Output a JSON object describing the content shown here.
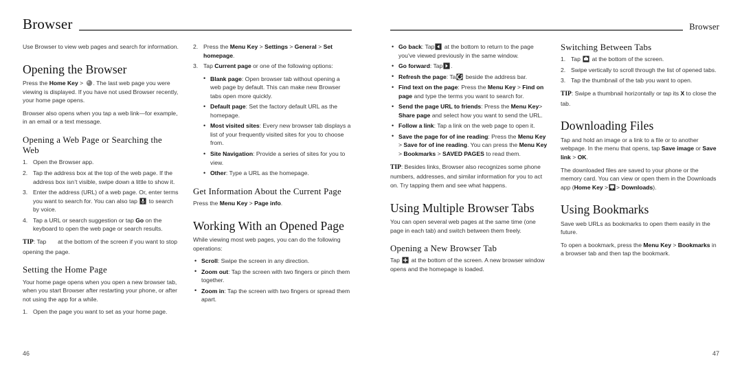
{
  "document": {
    "running_head_left": "Browser",
    "running_head_right": "Browser"
  },
  "left_page": {
    "page_number": "46",
    "col1": {
      "intro": "Use Browser to view web pages and search for information.",
      "h_opening_browser": "Opening the Browser",
      "opening_p1_a": "Press the ",
      "opening_p1_home_key": "Home Key",
      "opening_p1_b": " > ",
      "opening_p1_c": ". The last web page you were viewing is displayed. If you have not used Browser recently, your home page opens.",
      "opening_p2": "Browser also opens when you tap a web link—for example, in an email or a text message.",
      "h_opening_webpage": "Opening a Web Page or Searching the Web",
      "steps": [
        {
          "marker": "1.",
          "text": "Open the Browser app."
        },
        {
          "marker": "2.",
          "text": "Tap the address box at the top of the web page. If the address box isn’t visible, swipe down a little to show it."
        },
        {
          "marker": "3.",
          "text_a": "Enter the address (URL) of a web page. Or, enter terms you want to search for. You can also tap ",
          "icon": "microphone-icon",
          "text_b": " to search by voice."
        },
        {
          "marker": "4.",
          "text_a": "Tap a URL or search suggestion or tap ",
          "bold": "Go",
          "text_b": " on the keyboard to open the web page or search results."
        }
      ],
      "tip_label": "TIP",
      "tip_text_a": ": Tap ",
      "tip_text_b": "      at the bottom of the screen if you want to stop opening the page.",
      "h_setting_home": "Setting the Home Page",
      "setting_p1": "Your home page opens when you open a new browser tab, when you start Browser after restarting your phone, or after not using the app for a while.",
      "setting_step1_marker": "1.",
      "setting_step1": "Open the page you want to set as your home page."
    },
    "col2": {
      "step2_marker": "2.",
      "step2_a": "Press the ",
      "step2_menu_key": "Menu Key",
      "step2_b": " > ",
      "step2_settings": "Settings",
      "step2_c": " > ",
      "step2_general": "General",
      "step2_d": " > ",
      "step2_set_homepage": "Set homepage",
      "step2_e": ".",
      "step3_marker": "3.",
      "step3_a": "Tap ",
      "step3_current_page": "Current page",
      "step3_b": " or one of the following options:",
      "options": [
        {
          "label": "Blank page",
          "text": ": Open browser tab without opening a web page by default. This can make new Browser tabs open more quickly."
        },
        {
          "label": "Default page",
          "text": ": Set the factory default URL as the homepage."
        },
        {
          "label": "Most visited sites",
          "text": ": Every new browser tab displays a list of your frequently visited sites for you to choose from."
        },
        {
          "label": "Site Navigation",
          "text": ": Provide a series of sites for you to view."
        },
        {
          "label": "Other",
          "text": ": Type a URL as the homepage."
        }
      ],
      "h_get_info": "Get Information About the Current Page",
      "get_info_a": "Press the ",
      "get_info_menu_key": "Menu Key",
      "get_info_b": " > ",
      "get_info_page_info": "Page info",
      "get_info_c": ".",
      "h_working_with": "Working With an Opened Page",
      "working_p1": "While viewing most web pages, you can do the following operations:",
      "operations": [
        {
          "label": "Scroll",
          "text": ": Swipe the screen in any direction."
        },
        {
          "label": "Zoom out",
          "text": ": Tap the screen with two fingers or pinch them together."
        },
        {
          "label": "Zoom in",
          "text": ": Tap the screen with two fingers or spread them apart."
        }
      ]
    }
  },
  "right_page": {
    "page_number": "47",
    "col1": {
      "bullets": [
        {
          "label": "Go back",
          "text_a": ": Tap",
          "icon": "back-arrow-icon",
          "text_b": " at the bottom to return to the page you’ve viewed previously in the same window."
        },
        {
          "label": "Go forward",
          "text_a": ": Tap",
          "icon": "forward-arrow-icon",
          "text_b": "."
        },
        {
          "label": "Refresh the page",
          "text_a": ": Ta",
          "icon": "refresh-icon",
          "text_b": " beside the address bar."
        },
        {
          "label": "Find text on the page",
          "text_a": ": Press the ",
          "bold1": "Menu Key",
          "text_b": " > ",
          "bold2": "Find on page",
          "text_c": " and type the terms you want to search for."
        },
        {
          "label": "Send the page URL to friends",
          "text_a": ": Press the ",
          "bold1": "Menu Key",
          "text_b": "> ",
          "bold2": "Share page",
          "text_c": " and select how you want to send the URL."
        },
        {
          "label": "Follow a link",
          "text_a": ": Tap a link on the web page to open it."
        }
      ],
      "save_label": "Save the page for of ine reading",
      "save_a": ": Press the ",
      "save_menu_key": "Menu Key",
      "save_b": " > ",
      "save_bold2": "Save for of ine reading",
      "save_c": ". You can press the ",
      "save_menu_key2": "Menu Key",
      "save_d": " > ",
      "save_bookmarks": "Bookmarks",
      "save_e": " > ",
      "save_saved_pages": "SAVED PAGES",
      "save_f": " to read them.",
      "tip_label": "TIP",
      "tip_text": ": Besides links, Browser also recognizes some phone numbers, addresses, and similar information for you to act on. Try tapping them and see what happens.",
      "h_multiple_tabs": "Using Multiple Browser Tabs",
      "multiple_p1": "You can open several web pages at the same time (one page in each tab) and switch between them freely.",
      "h_new_tab": "Opening a New Browser Tab",
      "new_tab_a": "Tap ",
      "new_tab_icon": "plus-icon",
      "new_tab_b": " at the bottom of the screen. A new browser window opens and the homepage is loaded."
    },
    "col2": {
      "h_switching": "Switching Between Tabs",
      "steps": [
        {
          "marker": "1.",
          "text_a": "Tap ",
          "icon": "tabs-icon",
          "text_b": " at the bottom of the screen."
        },
        {
          "marker": "2.",
          "text": "Swipe vertically to scroll through the list of opened tabs."
        },
        {
          "marker": "3.",
          "text": "Tap the thumbnail of the tab you want to open."
        }
      ],
      "tip_label": "TIP",
      "tip_a": ": Swipe a thumbnail horizontally or tap its ",
      "tip_x": "X",
      "tip_b": " to close the tab.",
      "h_downloading": "Downloading Files",
      "download_p1_a": "Tap and hold an image or a link to a file or to another webpage. In the menu that opens, tap ",
      "download_save_image": "Save image",
      "download_p1_b": " or ",
      "download_save_link": "Save link",
      "download_p1_c": " > ",
      "download_ok": "OK",
      "download_p1_d": ".",
      "download_p2_a": "The downloaded files are saved to your phone or the memory card. You can view or open them in the Downloads app (",
      "download_home_key": "Home Key",
      "download_p2_b": " >",
      "download_apps_icon": "apps-grid-icon",
      "download_p2_c": "> ",
      "download_downloads": "Downloads",
      "download_p2_d": ").",
      "h_bookmarks": "Using Bookmarks",
      "bookmarks_p1": "Save web URLs as bookmarks to open them easily in the future.",
      "bookmarks_p2_a": "To open a bookmark, press the ",
      "bookmarks_menu_key": "Menu Key",
      "bookmarks_p2_b": " > ",
      "bookmarks_bold": "Bookmarks",
      "bookmarks_p2_c": " in a browser tab and then tap the bookmark."
    }
  },
  "colors": {
    "text": "#1a1a1a",
    "body_text": "#333333",
    "rule": "#6e6e6e",
    "icon_fill": "#2b2b2b",
    "page_bg": "#ffffff"
  }
}
